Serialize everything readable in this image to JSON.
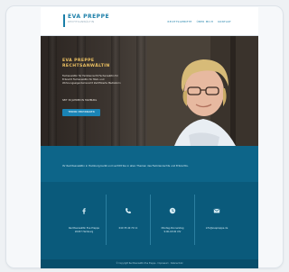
{
  "header": {
    "logo_name": "EVA PREPPE",
    "logo_subtitle": "RECHTSANWÄLTIN",
    "nav": [
      "RECHTSGEBIETE",
      "ÜBER MICH",
      "KONTAKT"
    ]
  },
  "hero": {
    "title_line1": "EVA PREPPE",
    "title_line2": "RECHTSANWÄLTIN",
    "description": "Fachanwältin für Familienrecht Fachanwältin für Erbrecht Fachanwältin für Miet- und Wohnungseigentumsrecht Zertifizierte Mediatorin",
    "meta": "SEIT 30 JAHREN IN HAMBURG",
    "button_label": "TERMIN VEREINBAREN"
  },
  "info": {
    "text": "Ihr Rechtsanwältin in Hamburg berät und vertritt Sie in allen Themen des Familienrechts und Erbrechts."
  },
  "contact": {
    "columns": [
      {
        "icon": "facebook-icon",
        "text_line1": "Rechtsanwältin Eva Preppe",
        "text_line2": "20457 Hamburg"
      },
      {
        "icon": "phone-icon",
        "text_line1": "040 35 40 70 11",
        "text_line2": ""
      },
      {
        "icon": "clock-icon",
        "text_line1": "Montag-Donnerstag",
        "text_line2": "9:00-18:00 Uhr"
      },
      {
        "icon": "mail-icon",
        "text_line1": "info@evapreppe.de",
        "text_line2": ""
      }
    ]
  },
  "footer": {
    "text": "© Copyright Rechtsanwältin Eva Preppe · Impressum · Datenschutz"
  },
  "colors": {
    "accent": "#1a7ea8",
    "hero_title": "#f0c463",
    "band": "#0d6589",
    "contact_bg": "#0a5a7b"
  }
}
